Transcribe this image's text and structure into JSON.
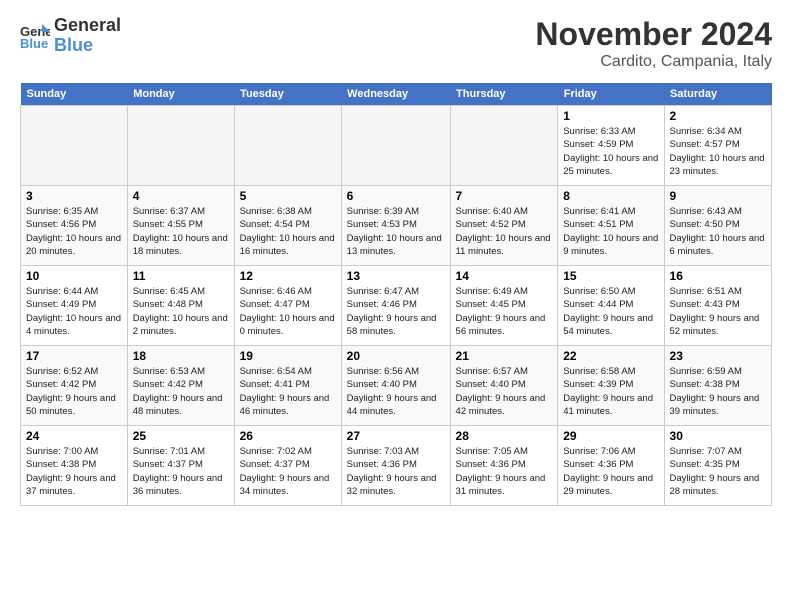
{
  "header": {
    "logo_line1": "General",
    "logo_line2": "Blue",
    "month_title": "November 2024",
    "location": "Cardito, Campania, Italy"
  },
  "weekdays": [
    "Sunday",
    "Monday",
    "Tuesday",
    "Wednesday",
    "Thursday",
    "Friday",
    "Saturday"
  ],
  "weeks": [
    [
      {
        "day": "",
        "empty": true
      },
      {
        "day": "",
        "empty": true
      },
      {
        "day": "",
        "empty": true
      },
      {
        "day": "",
        "empty": true
      },
      {
        "day": "",
        "empty": true
      },
      {
        "day": "1",
        "info": "Sunrise: 6:33 AM\nSunset: 4:59 PM\nDaylight: 10 hours and 25 minutes."
      },
      {
        "day": "2",
        "info": "Sunrise: 6:34 AM\nSunset: 4:57 PM\nDaylight: 10 hours and 23 minutes."
      }
    ],
    [
      {
        "day": "3",
        "info": "Sunrise: 6:35 AM\nSunset: 4:56 PM\nDaylight: 10 hours and 20 minutes."
      },
      {
        "day": "4",
        "info": "Sunrise: 6:37 AM\nSunset: 4:55 PM\nDaylight: 10 hours and 18 minutes."
      },
      {
        "day": "5",
        "info": "Sunrise: 6:38 AM\nSunset: 4:54 PM\nDaylight: 10 hours and 16 minutes."
      },
      {
        "day": "6",
        "info": "Sunrise: 6:39 AM\nSunset: 4:53 PM\nDaylight: 10 hours and 13 minutes."
      },
      {
        "day": "7",
        "info": "Sunrise: 6:40 AM\nSunset: 4:52 PM\nDaylight: 10 hours and 11 minutes."
      },
      {
        "day": "8",
        "info": "Sunrise: 6:41 AM\nSunset: 4:51 PM\nDaylight: 10 hours and 9 minutes."
      },
      {
        "day": "9",
        "info": "Sunrise: 6:43 AM\nSunset: 4:50 PM\nDaylight: 10 hours and 6 minutes."
      }
    ],
    [
      {
        "day": "10",
        "info": "Sunrise: 6:44 AM\nSunset: 4:49 PM\nDaylight: 10 hours and 4 minutes."
      },
      {
        "day": "11",
        "info": "Sunrise: 6:45 AM\nSunset: 4:48 PM\nDaylight: 10 hours and 2 minutes."
      },
      {
        "day": "12",
        "info": "Sunrise: 6:46 AM\nSunset: 4:47 PM\nDaylight: 10 hours and 0 minutes."
      },
      {
        "day": "13",
        "info": "Sunrise: 6:47 AM\nSunset: 4:46 PM\nDaylight: 9 hours and 58 minutes."
      },
      {
        "day": "14",
        "info": "Sunrise: 6:49 AM\nSunset: 4:45 PM\nDaylight: 9 hours and 56 minutes."
      },
      {
        "day": "15",
        "info": "Sunrise: 6:50 AM\nSunset: 4:44 PM\nDaylight: 9 hours and 54 minutes."
      },
      {
        "day": "16",
        "info": "Sunrise: 6:51 AM\nSunset: 4:43 PM\nDaylight: 9 hours and 52 minutes."
      }
    ],
    [
      {
        "day": "17",
        "info": "Sunrise: 6:52 AM\nSunset: 4:42 PM\nDaylight: 9 hours and 50 minutes."
      },
      {
        "day": "18",
        "info": "Sunrise: 6:53 AM\nSunset: 4:42 PM\nDaylight: 9 hours and 48 minutes."
      },
      {
        "day": "19",
        "info": "Sunrise: 6:54 AM\nSunset: 4:41 PM\nDaylight: 9 hours and 46 minutes."
      },
      {
        "day": "20",
        "info": "Sunrise: 6:56 AM\nSunset: 4:40 PM\nDaylight: 9 hours and 44 minutes."
      },
      {
        "day": "21",
        "info": "Sunrise: 6:57 AM\nSunset: 4:40 PM\nDaylight: 9 hours and 42 minutes."
      },
      {
        "day": "22",
        "info": "Sunrise: 6:58 AM\nSunset: 4:39 PM\nDaylight: 9 hours and 41 minutes."
      },
      {
        "day": "23",
        "info": "Sunrise: 6:59 AM\nSunset: 4:38 PM\nDaylight: 9 hours and 39 minutes."
      }
    ],
    [
      {
        "day": "24",
        "info": "Sunrise: 7:00 AM\nSunset: 4:38 PM\nDaylight: 9 hours and 37 minutes."
      },
      {
        "day": "25",
        "info": "Sunrise: 7:01 AM\nSunset: 4:37 PM\nDaylight: 9 hours and 36 minutes."
      },
      {
        "day": "26",
        "info": "Sunrise: 7:02 AM\nSunset: 4:37 PM\nDaylight: 9 hours and 34 minutes."
      },
      {
        "day": "27",
        "info": "Sunrise: 7:03 AM\nSunset: 4:36 PM\nDaylight: 9 hours and 32 minutes."
      },
      {
        "day": "28",
        "info": "Sunrise: 7:05 AM\nSunset: 4:36 PM\nDaylight: 9 hours and 31 minutes."
      },
      {
        "day": "29",
        "info": "Sunrise: 7:06 AM\nSunset: 4:36 PM\nDaylight: 9 hours and 29 minutes."
      },
      {
        "day": "30",
        "info": "Sunrise: 7:07 AM\nSunset: 4:35 PM\nDaylight: 9 hours and 28 minutes."
      }
    ]
  ]
}
